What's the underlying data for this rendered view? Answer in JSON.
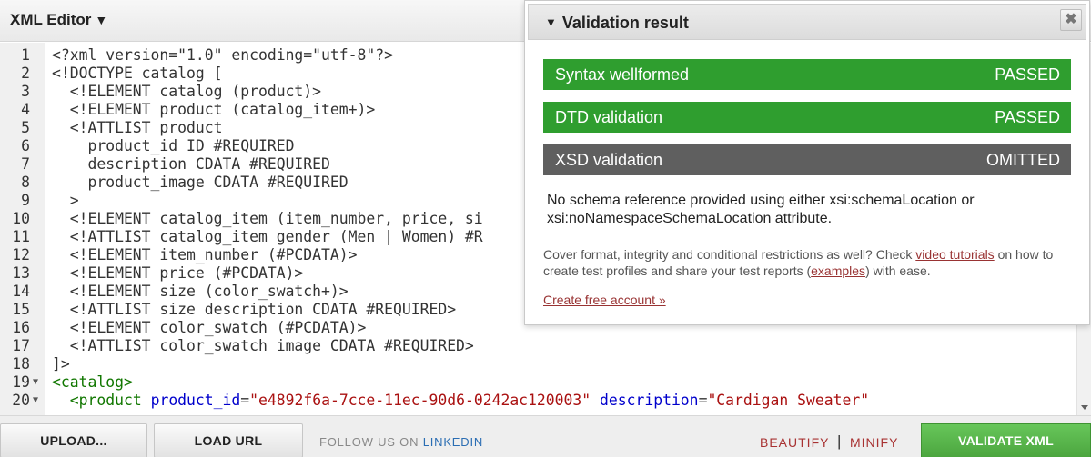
{
  "header": {
    "title": "XML Editor",
    "caret": "▼"
  },
  "editor": {
    "lines": [
      {
        "n": "1",
        "fold": "",
        "tokens": [
          [
            "plain",
            "<?xml version=\"1.0\" encoding=\"utf-8\"?>"
          ]
        ]
      },
      {
        "n": "2",
        "fold": "",
        "tokens": [
          [
            "plain",
            "<!DOCTYPE catalog ["
          ]
        ]
      },
      {
        "n": "3",
        "fold": "",
        "tokens": [
          [
            "plain",
            "  <!ELEMENT catalog (product)>"
          ]
        ]
      },
      {
        "n": "4",
        "fold": "",
        "tokens": [
          [
            "plain",
            "  <!ELEMENT product (catalog_item+)>"
          ]
        ]
      },
      {
        "n": "5",
        "fold": "",
        "tokens": [
          [
            "plain",
            "  <!ATTLIST product"
          ]
        ]
      },
      {
        "n": "6",
        "fold": "",
        "tokens": [
          [
            "plain",
            "    product_id ID #REQUIRED"
          ]
        ]
      },
      {
        "n": "7",
        "fold": "",
        "tokens": [
          [
            "plain",
            "    description CDATA #REQUIRED"
          ]
        ]
      },
      {
        "n": "8",
        "fold": "",
        "tokens": [
          [
            "plain",
            "    product_image CDATA #REQUIRED"
          ]
        ]
      },
      {
        "n": "9",
        "fold": "",
        "tokens": [
          [
            "plain",
            "  >"
          ]
        ]
      },
      {
        "n": "10",
        "fold": "",
        "tokens": [
          [
            "plain",
            "  <!ELEMENT catalog_item (item_number, price, si"
          ]
        ]
      },
      {
        "n": "11",
        "fold": "",
        "tokens": [
          [
            "plain",
            "  <!ATTLIST catalog_item gender (Men | Women) #R"
          ]
        ]
      },
      {
        "n": "12",
        "fold": "",
        "tokens": [
          [
            "plain",
            "  <!ELEMENT item_number (#PCDATA)>"
          ]
        ]
      },
      {
        "n": "13",
        "fold": "",
        "tokens": [
          [
            "plain",
            "  <!ELEMENT price (#PCDATA)>"
          ]
        ]
      },
      {
        "n": "14",
        "fold": "",
        "tokens": [
          [
            "plain",
            "  <!ELEMENT size (color_swatch+)>"
          ]
        ]
      },
      {
        "n": "15",
        "fold": "",
        "tokens": [
          [
            "plain",
            "  <!ATTLIST size description CDATA #REQUIRED>"
          ]
        ]
      },
      {
        "n": "16",
        "fold": "",
        "tokens": [
          [
            "plain",
            "  <!ELEMENT color_swatch (#PCDATA)>"
          ]
        ]
      },
      {
        "n": "17",
        "fold": "",
        "tokens": [
          [
            "plain",
            "  <!ATTLIST color_swatch image CDATA #REQUIRED>"
          ]
        ]
      },
      {
        "n": "18",
        "fold": "",
        "tokens": [
          [
            "plain",
            "]>"
          ]
        ]
      },
      {
        "n": "19",
        "fold": "▼",
        "tokens": [
          [
            "tag",
            "<catalog>"
          ]
        ]
      },
      {
        "n": "20",
        "fold": "▼",
        "tokens": [
          [
            "plain",
            "  "
          ],
          [
            "tag",
            "<product"
          ],
          [
            "plain",
            " "
          ],
          [
            "attr",
            "product_id"
          ],
          [
            "plain",
            "="
          ],
          [
            "str",
            "\"e4892f6a-7cce-11ec-90d6-0242ac120003\""
          ],
          [
            "plain",
            " "
          ],
          [
            "attr",
            "description"
          ],
          [
            "plain",
            "="
          ],
          [
            "str",
            "\"Cardigan Sweater\""
          ]
        ]
      }
    ]
  },
  "panel": {
    "title": "Validation result",
    "collapse_icon": "▼",
    "close_icon": "✖",
    "results": [
      {
        "label": "Syntax wellformed",
        "status": "PASSED",
        "kind": "passed"
      },
      {
        "label": "DTD validation",
        "status": "PASSED",
        "kind": "passed"
      },
      {
        "label": "XSD validation",
        "status": "OMITTED",
        "kind": "omitted"
      }
    ],
    "note": "No schema reference provided using either xsi:schemaLocation or xsi:noNamespaceSchemaLocation attribute.",
    "promo_part1": "Cover format, integrity and conditional restrictions as well? Check ",
    "promo_link1": "video tutorials",
    "promo_part2": " on how to create test profiles and share your test reports (",
    "promo_link2": "examples",
    "promo_part3": ") with ease.",
    "create_account": "Create free account »"
  },
  "footer": {
    "upload": "UPLOAD...",
    "load_url": "LOAD URL",
    "follow_prefix": "FOLLOW US ON ",
    "follow_link": "LINKEDIN",
    "beautify": "BEAUTIFY",
    "separator": "|",
    "minify": "MINIFY",
    "validate": "VALIDATE XML"
  },
  "colors": {
    "passed": "#2f9e2f",
    "omitted": "#5f5f5f",
    "validate_button": "#55b148",
    "link": "#993333",
    "xml_tag": "#117700",
    "xml_attr": "#0000cc",
    "xml_string": "#aa1111"
  }
}
